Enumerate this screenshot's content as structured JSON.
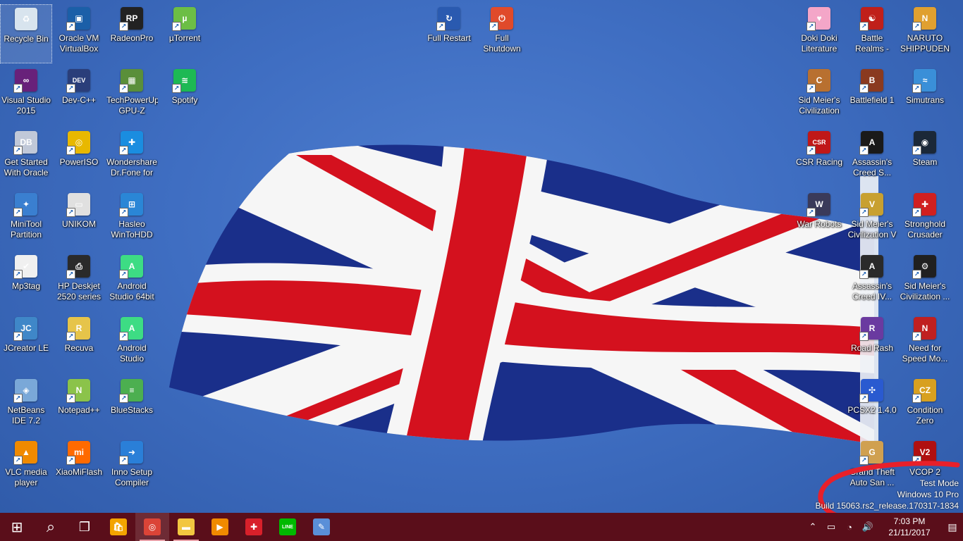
{
  "desktop": {
    "icons": [
      {
        "label": "Recycle Bin",
        "icon": "recycle-bin-icon",
        "color": "#d8e4ee",
        "glyph": "♻",
        "shortcut": false
      },
      {
        "label": "Oracle VM VirtualBox",
        "icon": "virtualbox-icon",
        "color": "#1b5fa8",
        "glyph": "▣",
        "shortcut": true
      },
      {
        "label": "RadeonPro",
        "icon": "radeonpro-icon",
        "color": "#222222",
        "glyph": "RP",
        "shortcut": true
      },
      {
        "label": "µTorrent",
        "icon": "utorrent-icon",
        "color": "#6cbe45",
        "glyph": "µ",
        "shortcut": true
      },
      {
        "label": "Visual Studio 2015",
        "icon": "visual-studio-icon",
        "color": "#68217a",
        "glyph": "∞",
        "shortcut": true
      },
      {
        "label": "Dev-C++",
        "icon": "devcpp-icon",
        "color": "#2a3e7a",
        "glyph": "DEV",
        "shortcut": true
      },
      {
        "label": "TechPowerUp GPU-Z",
        "icon": "gpuz-icon",
        "color": "#5a8f3a",
        "glyph": "▦",
        "shortcut": true
      },
      {
        "label": "Spotify",
        "icon": "spotify-icon",
        "color": "#1db954",
        "glyph": "≋",
        "shortcut": true
      },
      {
        "label": "Get Started With Oracle Database",
        "icon": "oracle-db-icon",
        "color": "#c0c8d8",
        "glyph": "DB",
        "shortcut": true
      },
      {
        "label": "PowerISO",
        "icon": "poweriso-icon",
        "color": "#e8b800",
        "glyph": "◎",
        "shortcut": true
      },
      {
        "label": "Wondershare Dr.Fone for Android",
        "icon": "drfone-icon",
        "color": "#1a8de0",
        "glyph": "✚",
        "shortcut": true
      },
      {
        "label": "MiniTool Partition Wizard",
        "icon": "minitool-icon",
        "color": "#3a7fd0",
        "glyph": "✦",
        "shortcut": true
      },
      {
        "label": "UNIKOM",
        "icon": "unikom-icon",
        "color": "#e0e0e0",
        "glyph": "▭",
        "shortcut": true
      },
      {
        "label": "Hasleo WinToHDD",
        "icon": "wintohdd-icon",
        "color": "#2a86d6",
        "glyph": "⊞",
        "shortcut": true
      },
      {
        "label": "Mp3tag",
        "icon": "mp3tag-icon",
        "color": "#f0f0f0",
        "glyph": "✔",
        "shortcut": true
      },
      {
        "label": "HP Deskjet 2520 series",
        "icon": "printer-icon",
        "color": "#2a2a2a",
        "glyph": "⎙",
        "shortcut": true
      },
      {
        "label": "Android Studio 64bit",
        "icon": "android-studio-icon",
        "color": "#3ddc84",
        "glyph": "A",
        "shortcut": true
      },
      {
        "label": "JCreator LE",
        "icon": "jcreator-icon",
        "color": "#3f87c8",
        "glyph": "JC",
        "shortcut": true
      },
      {
        "label": "Recuva",
        "icon": "recuva-icon",
        "color": "#e6c44a",
        "glyph": "R",
        "shortcut": true
      },
      {
        "label": "Android Studio",
        "icon": "android-studio-icon",
        "color": "#3ddc84",
        "glyph": "A",
        "shortcut": true
      },
      {
        "label": "NetBeans IDE 7.2",
        "icon": "netbeans-icon",
        "color": "#7aa8d8",
        "glyph": "◈",
        "shortcut": true
      },
      {
        "label": "Notepad++",
        "icon": "notepadpp-icon",
        "color": "#8bc34a",
        "glyph": "N",
        "shortcut": true
      },
      {
        "label": "BlueStacks",
        "icon": "bluestacks-icon",
        "color": "#4caf50",
        "glyph": "≡",
        "shortcut": true
      },
      {
        "label": "VLC media player",
        "icon": "vlc-icon",
        "color": "#f08a00",
        "glyph": "▲",
        "shortcut": true
      },
      {
        "label": "XiaoMiFlash",
        "icon": "xiaomiflash-icon",
        "color": "#ff6a00",
        "glyph": "mi",
        "shortcut": true
      },
      {
        "label": "Inno Setup Compiler",
        "icon": "innosetup-icon",
        "color": "#2a7fd8",
        "glyph": "➜",
        "shortcut": true
      },
      {
        "label": "Full Restart",
        "icon": "restart-icon",
        "color": "#2a5ab0",
        "glyph": "↻",
        "shortcut": true
      },
      {
        "label": "Full Shutdown",
        "icon": "shutdown-icon",
        "color": "#e04a2a",
        "glyph": "⏻",
        "shortcut": true
      },
      {
        "label": "Doki Doki Literature Club",
        "icon": "ddlc-icon",
        "color": "#f4a6c8",
        "glyph": "♥",
        "shortcut": true
      },
      {
        "label": "Battle Realms - Winter of the Wolf",
        "icon": "battle-realms-icon",
        "color": "#c0201a",
        "glyph": "☯",
        "shortcut": true
      },
      {
        "label": "NARUTO SHIPPUDEN",
        "icon": "naruto-icon",
        "color": "#e0a030",
        "glyph": "N",
        "shortcut": true
      },
      {
        "label": "Sid Meier's Civilization IV",
        "icon": "civ4-icon",
        "color": "#b87030",
        "glyph": "C",
        "shortcut": true
      },
      {
        "label": "Battlefield 1",
        "icon": "battlefield-icon",
        "color": "#8a3a20",
        "glyph": "B",
        "shortcut": true
      },
      {
        "label": "Simutrans",
        "icon": "simutrans-icon",
        "color": "#3a8fd8",
        "glyph": "≈",
        "shortcut": true
      },
      {
        "label": "CSR Racing",
        "icon": "csr-icon",
        "color": "#c01818",
        "glyph": "CSR",
        "shortcut": true
      },
      {
        "label": "Assassin's Creed S...",
        "icon": "assassins-creed-icon",
        "color": "#1a1a1a",
        "glyph": "A",
        "shortcut": true
      },
      {
        "label": "Steam",
        "icon": "steam-icon",
        "color": "#1b2838",
        "glyph": "◉",
        "shortcut": true
      },
      {
        "label": "War Robots",
        "icon": "war-robots-icon",
        "color": "#3a3a5a",
        "glyph": "W",
        "shortcut": true
      },
      {
        "label": "Sid Meier's Civilization V",
        "icon": "civ5-icon",
        "color": "#c8a030",
        "glyph": "V",
        "shortcut": true
      },
      {
        "label": "Stronghold Crusader",
        "icon": "stronghold-icon",
        "color": "#d02020",
        "glyph": "✚",
        "shortcut": true
      },
      {
        "label": "Assassin's Creed IV...",
        "icon": "assassins-creed-icon",
        "color": "#2a2a2a",
        "glyph": "A",
        "shortcut": true
      },
      {
        "label": "Sid Meier's Civilization ...",
        "icon": "civ-icon",
        "color": "#202020",
        "glyph": "⚙",
        "shortcut": true
      },
      {
        "label": "Road Rash",
        "icon": "road-rash-icon",
        "color": "#6a3aa0",
        "glyph": "R",
        "shortcut": true
      },
      {
        "label": "Need for Speed Mo...",
        "icon": "nfs-icon",
        "color": "#c02020",
        "glyph": "N",
        "shortcut": true
      },
      {
        "label": "PCSX2 1.4.0",
        "icon": "pcsx2-icon",
        "color": "#2a5ad0",
        "glyph": "✣",
        "shortcut": true
      },
      {
        "label": "Condition Zero",
        "icon": "condition-zero-icon",
        "color": "#d8a020",
        "glyph": "CZ",
        "shortcut": true
      },
      {
        "label": "Grand Theft Auto San ...",
        "icon": "gta-sa-icon",
        "color": "#d0a050",
        "glyph": "G",
        "shortcut": true
      },
      {
        "label": "VCOP 2",
        "icon": "vcop2-icon",
        "color": "#b01010",
        "glyph": "V2",
        "shortcut": true
      }
    ]
  },
  "watermark": {
    "line1": "Test Mode",
    "line2": "Windows 10 Pro",
    "line3": "Build 15063.rs2_release.170317-1834",
    "highlight_color": "#e8202a"
  },
  "flag": {
    "colors": {
      "blue": "#1a2f8a",
      "red": "#d4111e",
      "white": "#f6f6f6"
    }
  },
  "taskbar": {
    "background": "#5a0e1a",
    "start": {
      "icon": "windows-start-icon",
      "glyph": "⊞"
    },
    "search": {
      "icon": "search-icon",
      "glyph": "⌕"
    },
    "task_view": {
      "icon": "task-view-icon",
      "glyph": "❐"
    },
    "apps": [
      {
        "name": "store",
        "icon": "store-icon",
        "glyph": "🛍",
        "color": "#f3a400",
        "running": false,
        "active": false
      },
      {
        "name": "chrome",
        "icon": "chrome-icon",
        "glyph": "◎",
        "color": "#db4437",
        "running": true,
        "active": true
      },
      {
        "name": "file-explorer",
        "icon": "folder-icon",
        "glyph": "▬",
        "color": "#f2c640",
        "running": true,
        "active": false
      },
      {
        "name": "media-player",
        "icon": "media-player-icon",
        "glyph": "▶",
        "color": "#f08a00",
        "running": false,
        "active": false
      },
      {
        "name": "antivirus",
        "icon": "shield-icon",
        "glyph": "✚",
        "color": "#d8202a",
        "running": false,
        "active": false
      },
      {
        "name": "line",
        "icon": "line-icon",
        "glyph": "LINE",
        "color": "#00b900",
        "running": false,
        "active": false
      },
      {
        "name": "paint",
        "icon": "paint-icon",
        "glyph": "✎",
        "color": "#5a8fd8",
        "running": false,
        "active": false
      }
    ],
    "tray": {
      "chevron": "⌃",
      "battery": "▭",
      "network": "◔",
      "volume": "🔊",
      "time": "7:03 PM",
      "date": "21/11/2017",
      "notifications": "▤"
    }
  }
}
